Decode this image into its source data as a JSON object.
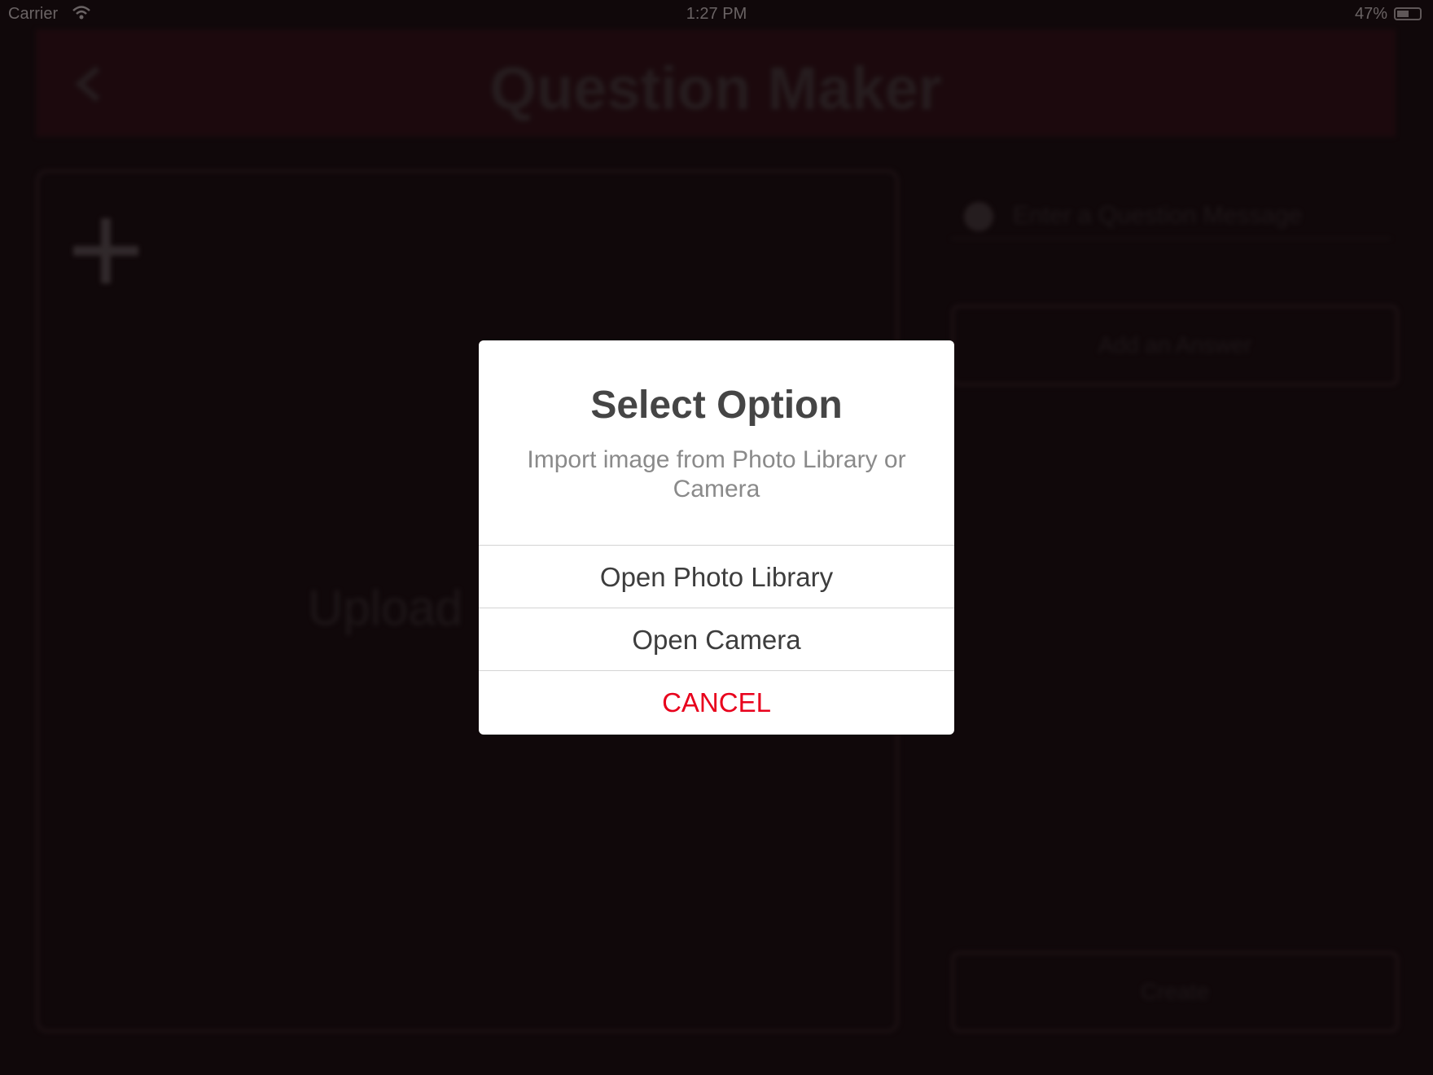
{
  "status_bar": {
    "carrier": "Carrier",
    "time": "1:27 PM",
    "battery_percent": "47%",
    "icons": [
      "wifi-icon",
      "battery-icon"
    ]
  },
  "background_app": {
    "nav_title": "Question Maker",
    "back_icon": "chevron-left-icon",
    "image_panel": {
      "plus_icon": "plus-icon",
      "upload_label": "Upload"
    },
    "question_field_placeholder": "Enter a Question Message",
    "add_button_label": "Add an Answer",
    "create_button_label": "Create"
  },
  "dialog": {
    "title": "Select Option",
    "message": "Import image from Photo Library or Camera",
    "actions": [
      {
        "label": "Open Photo Library"
      },
      {
        "label": "Open Camera"
      },
      {
        "label": "CANCEL"
      }
    ]
  },
  "colors": {
    "cancel": "#e8001c",
    "nav_bar": "#2b0f15",
    "background": "#1a0d10"
  }
}
